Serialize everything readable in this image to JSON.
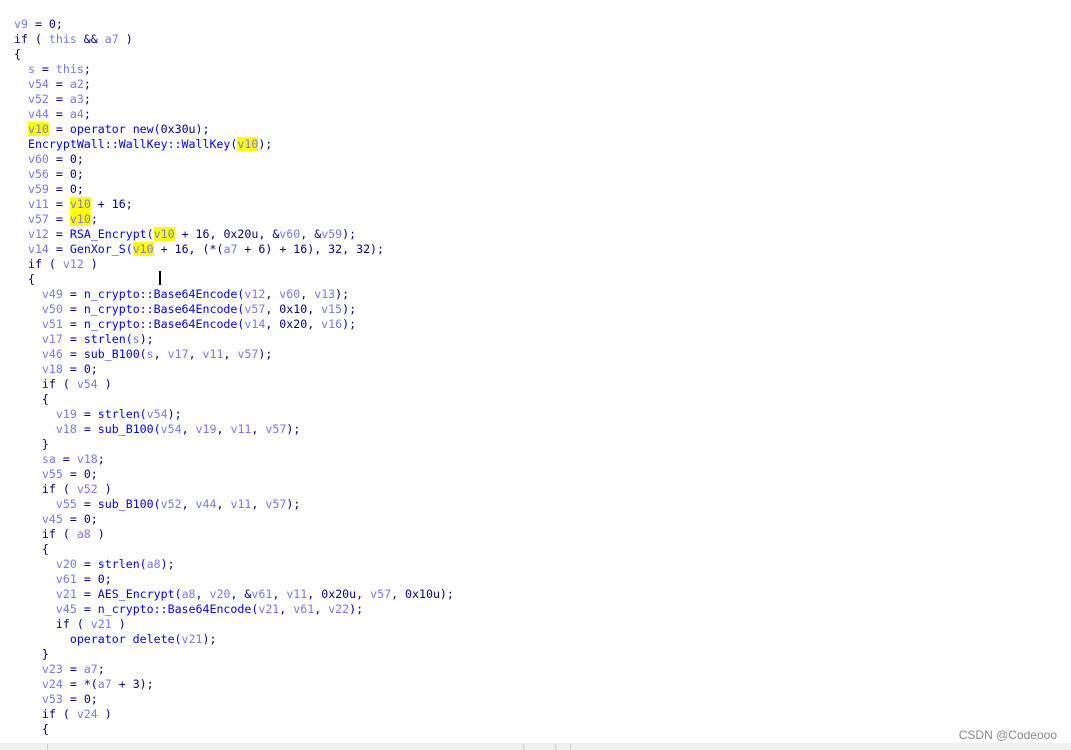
{
  "highlight": "v10",
  "colors": {
    "text": "#000080",
    "variable": "#7878f0",
    "function": "#0000ff",
    "highlight": "#ffff00"
  },
  "lines": [
    {
      "indent": 0,
      "text": "v9 = 0;"
    },
    {
      "indent": 0,
      "text": "if ( this && a7 )"
    },
    {
      "indent": 0,
      "text": "{"
    },
    {
      "indent": 2,
      "text": "s = this;"
    },
    {
      "indent": 2,
      "text": "v54 = a2;"
    },
    {
      "indent": 2,
      "text": "v52 = a3;"
    },
    {
      "indent": 2,
      "text": "v44 = a4;"
    },
    {
      "indent": 2,
      "text": "v10 = operator new(0x30u);"
    },
    {
      "indent": 2,
      "text": "EncryptWall::WallKey::WallKey(v10);"
    },
    {
      "indent": 2,
      "text": "v60 = 0;"
    },
    {
      "indent": 2,
      "text": "v56 = 0;"
    },
    {
      "indent": 2,
      "text": "v59 = 0;"
    },
    {
      "indent": 2,
      "text": "v11 = v10 + 16;"
    },
    {
      "indent": 2,
      "text": "v57 = v10;"
    },
    {
      "indent": 2,
      "text": "v12 = RSA_Encrypt(v10 + 16, 0x20u, &v60, &v59);"
    },
    {
      "indent": 2,
      "text": "v14 = GenXor_S(v10 + 16, (*(a7 + 6) + 16), 32, 32);"
    },
    {
      "indent": 2,
      "text": "if ( v12 )"
    },
    {
      "indent": 2,
      "text": "{"
    },
    {
      "indent": 4,
      "text": "v49 = n_crypto::Base64Encode(v12, v60, v13);"
    },
    {
      "indent": 4,
      "text": "v50 = n_crypto::Base64Encode(v57, 0x10, v15);"
    },
    {
      "indent": 4,
      "text": "v51 = n_crypto::Base64Encode(v14, 0x20, v16);"
    },
    {
      "indent": 4,
      "text": "v17 = strlen(s);"
    },
    {
      "indent": 4,
      "text": "v46 = sub_B100(s, v17, v11, v57);"
    },
    {
      "indent": 4,
      "text": "v18 = 0;"
    },
    {
      "indent": 4,
      "text": "if ( v54 )"
    },
    {
      "indent": 4,
      "text": "{"
    },
    {
      "indent": 6,
      "text": "v19 = strlen(v54);"
    },
    {
      "indent": 6,
      "text": "v18 = sub_B100(v54, v19, v11, v57);"
    },
    {
      "indent": 4,
      "text": "}"
    },
    {
      "indent": 4,
      "text": "sa = v18;"
    },
    {
      "indent": 4,
      "text": "v55 = 0;"
    },
    {
      "indent": 4,
      "text": "if ( v52 )"
    },
    {
      "indent": 6,
      "text": "v55 = sub_B100(v52, v44, v11, v57);"
    },
    {
      "indent": 4,
      "text": "v45 = 0;"
    },
    {
      "indent": 4,
      "text": "if ( a8 )"
    },
    {
      "indent": 4,
      "text": "{"
    },
    {
      "indent": 6,
      "text": "v20 = strlen(a8);"
    },
    {
      "indent": 6,
      "text": "v61 = 0;"
    },
    {
      "indent": 6,
      "text": "v21 = AES_Encrypt(a8, v20, &v61, v11, 0x20u, v57, 0x10u);"
    },
    {
      "indent": 6,
      "text": "v45 = n_crypto::Base64Encode(v21, v61, v22);"
    },
    {
      "indent": 6,
      "text": "if ( v21 )"
    },
    {
      "indent": 8,
      "text": "operator delete(v21);"
    },
    {
      "indent": 4,
      "text": "}"
    },
    {
      "indent": 4,
      "text": "v23 = a7;"
    },
    {
      "indent": 4,
      "text": "v24 = *(a7 + 3);"
    },
    {
      "indent": 4,
      "text": "v53 = 0;"
    },
    {
      "indent": 4,
      "text": "if ( v24 )"
    },
    {
      "indent": 4,
      "text": "{"
    }
  ],
  "watermark": "CSDN @Codeooo"
}
